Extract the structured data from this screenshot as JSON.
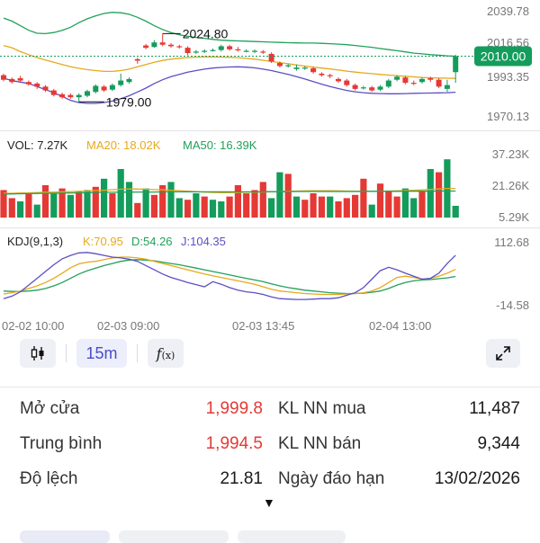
{
  "chart": {
    "price_axis": [
      "2039.78",
      "2016.56",
      "1993.35",
      "1970.13"
    ],
    "current_price": "2010.00",
    "high_label": "2024.80",
    "low_label": "1979.00",
    "volume_legend": {
      "vol": "VOL: 7.27K",
      "ma20": "MA20: 18.02K",
      "ma50": "MA50: 16.39K"
    },
    "volume_axis": [
      "37.23K",
      "21.26K",
      "5.29K"
    ],
    "kdj_legend": {
      "name": "KDJ(9,1,3)",
      "k": "K:70.95",
      "d": "D:54.26",
      "j": "J:104.35"
    },
    "kdj_axis": [
      "112.68",
      "-14.58"
    ],
    "time_axis": [
      "02-02 10:00",
      "02-03 09:00",
      "02-03 13:45",
      "02-04 13:00"
    ],
    "colors": {
      "up": "#149c5c",
      "down": "#e53935",
      "ma_yellow": "#e6a91c",
      "ma_green": "#22a05a",
      "boll_purple": "#5b4fc4",
      "price_tag": "#149c5c"
    }
  },
  "chart_data": {
    "type": "candlestick",
    "y_range": [
      1970.13,
      2039.78
    ],
    "last_price": 2010.0,
    "candles": [
      {
        "o": 1997.5,
        "c": 1994.5,
        "h": 1998.5,
        "l": 1993.5
      },
      {
        "o": 1995.0,
        "c": 1993.0,
        "h": 1996.0,
        "l": 1992.0
      },
      {
        "o": 1995.5,
        "c": 1994.0,
        "h": 1997.0,
        "l": 1993.0
      },
      {
        "o": 1993.0,
        "c": 1991.5,
        "h": 1994.0,
        "l": 1990.5
      },
      {
        "o": 1992.0,
        "c": 1990.0,
        "h": 1993.0,
        "l": 1988.5
      },
      {
        "o": 1990.0,
        "c": 1987.5,
        "h": 1991.0,
        "l": 1986.5
      },
      {
        "o": 1987.5,
        "c": 1984.5,
        "h": 1988.5,
        "l": 1983.5
      },
      {
        "o": 1985.0,
        "c": 1983.0,
        "h": 1986.0,
        "l": 1982.0
      },
      {
        "o": 1984.5,
        "c": 1983.0,
        "h": 1985.5,
        "l": 1982.0
      },
      {
        "o": 1983.0,
        "c": 1984.5,
        "h": 1985.5,
        "l": 1980.0
      },
      {
        "o": 1984.0,
        "c": 1987.0,
        "h": 1988.0,
        "l": 1983.0
      },
      {
        "o": 1986.5,
        "c": 1990.5,
        "h": 1991.5,
        "l": 1985.5
      },
      {
        "o": 1990.0,
        "c": 1987.5,
        "h": 1991.0,
        "l": 1986.5
      },
      {
        "o": 1988.0,
        "c": 1991.0,
        "h": 1992.0,
        "l": 1987.0
      },
      {
        "o": 1991.0,
        "c": 1994.0,
        "h": 1998.5,
        "l": 1990.0
      },
      {
        "o": 1993.0,
        "c": 1995.0,
        "h": 1996.0,
        "l": 1992.0
      },
      {
        "o": 2008.0,
        "c": 2007.0,
        "h": 2009.0,
        "l": 2005.0
      },
      {
        "o": 2017.0,
        "c": 2015.5,
        "h": 2018.0,
        "l": 2014.5
      },
      {
        "o": 2016.0,
        "c": 2019.0,
        "h": 2020.5,
        "l": 2015.5
      },
      {
        "o": 2019.0,
        "c": 2017.5,
        "h": 2024.8,
        "l": 2016.5
      },
      {
        "o": 2017.5,
        "c": 2016.5,
        "h": 2018.5,
        "l": 2015.5
      },
      {
        "o": 2016.5,
        "c": 2016.0,
        "h": 2017.5,
        "l": 2015.0
      },
      {
        "o": 2015.5,
        "c": 2012.0,
        "h": 2016.5,
        "l": 2010.5
      },
      {
        "o": 2012.5,
        "c": 2013.0,
        "h": 2014.0,
        "l": 2011.5
      },
      {
        "o": 2013.0,
        "c": 2013.5,
        "h": 2014.5,
        "l": 2012.0
      },
      {
        "o": 2013.5,
        "c": 2014.0,
        "h": 2015.0,
        "l": 2013.0
      },
      {
        "o": 2014.0,
        "c": 2016.5,
        "h": 2017.5,
        "l": 2013.0
      },
      {
        "o": 2016.5,
        "c": 2014.5,
        "h": 2017.5,
        "l": 2013.5
      },
      {
        "o": 2014.5,
        "c": 2014.0,
        "h": 2016.0,
        "l": 2013.0
      },
      {
        "o": 2013.5,
        "c": 2013.5,
        "h": 2014.5,
        "l": 2012.5
      },
      {
        "o": 2013.0,
        "c": 2013.5,
        "h": 2014.5,
        "l": 2012.0
      },
      {
        "o": 2013.0,
        "c": 2012.5,
        "h": 2014.0,
        "l": 2011.5
      },
      {
        "o": 2011.5,
        "c": 2006.5,
        "h": 2012.5,
        "l": 2005.5
      },
      {
        "o": 2005.5,
        "c": 2003.5,
        "h": 2006.5,
        "l": 2002.5
      },
      {
        "o": 2003.5,
        "c": 2004.0,
        "h": 2005.0,
        "l": 2002.5
      },
      {
        "o": 2001.5,
        "c": 2002.5,
        "h": 2004.5,
        "l": 2000.5
      },
      {
        "o": 2002.0,
        "c": 2002.5,
        "h": 2003.5,
        "l": 2001.0
      },
      {
        "o": 2002.0,
        "c": 1999.5,
        "h": 2003.0,
        "l": 1998.5
      },
      {
        "o": 1998.5,
        "c": 1997.5,
        "h": 1999.5,
        "l": 1996.5
      },
      {
        "o": 1997.5,
        "c": 1997.0,
        "h": 1998.5,
        "l": 1995.5
      },
      {
        "o": 1995.0,
        "c": 1993.5,
        "h": 1996.0,
        "l": 1992.5
      },
      {
        "o": 1994.0,
        "c": 1991.0,
        "h": 1995.0,
        "l": 1990.0
      },
      {
        "o": 1991.0,
        "c": 1988.5,
        "h": 1992.0,
        "l": 1987.5
      },
      {
        "o": 1989.0,
        "c": 1989.5,
        "h": 1990.5,
        "l": 1988.0
      },
      {
        "o": 1989.5,
        "c": 1987.5,
        "h": 1990.5,
        "l": 1986.5
      },
      {
        "o": 1988.0,
        "c": 1990.0,
        "h": 1991.0,
        "l": 1987.0
      },
      {
        "o": 1990.0,
        "c": 1994.0,
        "h": 1995.0,
        "l": 1989.0
      },
      {
        "o": 1994.5,
        "c": 1996.5,
        "h": 1997.5,
        "l": 1993.5
      },
      {
        "o": 1996.0,
        "c": 1992.5,
        "h": 1997.0,
        "l": 1991.5
      },
      {
        "o": 1992.5,
        "c": 1992.0,
        "h": 1994.0,
        "l": 1991.0
      },
      {
        "o": 1993.0,
        "c": 1995.0,
        "h": 1996.0,
        "l": 1992.0
      },
      {
        "o": 1995.5,
        "c": 1994.5,
        "h": 1996.5,
        "l": 1993.0
      },
      {
        "o": 1994.5,
        "c": 1990.0,
        "h": 1995.5,
        "l": 1989.0
      },
      {
        "o": 1988.5,
        "c": 1991.0,
        "h": 1994.5,
        "l": 1986.5
      },
      {
        "o": 1999.5,
        "c": 2010.0,
        "h": 2011.0,
        "l": 1992.5
      }
    ],
    "bollinger": {
      "upper": [
        2035,
        2033,
        2030,
        2027,
        2025,
        2024.8,
        2025.5,
        2027,
        2029,
        2032,
        2034.5,
        2036.5,
        2038,
        2038.8,
        2038.5,
        2037.5,
        2035.5,
        2033,
        2030,
        2027.5,
        2025.5,
        2024,
        2023,
        2022.3,
        2021.7,
        2021,
        2020.5,
        2020.2,
        2020,
        2019.8,
        2019.6,
        2019.4,
        2019.2,
        2019,
        2018.8,
        2018.7,
        2018.6,
        2018.6,
        2018.4,
        2018.2,
        2017.9,
        2017.5,
        2017,
        2016.4,
        2015.8,
        2015,
        2014.3,
        2013.6,
        2012.8,
        2012,
        2011.5,
        2011,
        2010.6,
        2010.2,
        2010
      ],
      "middle": [
        2017,
        2015.5,
        2013,
        2011,
        2009,
        2007.5,
        2006,
        2004.5,
        2003,
        2002,
        2001.2,
        2000.5,
        2000,
        2000,
        2000.5,
        2001.5,
        2003,
        2004.5,
        2006,
        2007.2,
        2008,
        2008.6,
        2009,
        2009.3,
        2009.5,
        2009.5,
        2009.4,
        2009.2,
        2009,
        2008.5,
        2008,
        2007.3,
        2006.5,
        2005.8,
        2005,
        2004.2,
        2003.5,
        2002.8,
        2002.2,
        2001.6,
        2000.9,
        2000.2,
        1999.5,
        1999,
        1998.5,
        1998,
        1997.6,
        1997.2,
        1996.8,
        1996.4,
        1996,
        1995.8,
        1995.6,
        1995.5,
        1995.4
      ],
      "lower": [
        1995.5,
        1994,
        1993,
        1992,
        1990,
        1988,
        1986,
        1983.5,
        1981,
        1979.5,
        1979,
        1979,
        1979.5,
        1980.5,
        1982,
        1984,
        1986.5,
        1989,
        1992,
        1994.5,
        1996.5,
        1998,
        1999.5,
        2000.5,
        2001.5,
        2002.2,
        2002.6,
        2002.9,
        2003,
        2002.8,
        2002.3,
        2001.5,
        2000.5,
        1999.3,
        1998,
        1996.5,
        1995,
        1993.3,
        1991.6,
        1990,
        1988.7,
        1987.5,
        1986.6,
        1986,
        1985.6,
        1985.4,
        1985.3,
        1985.3,
        1985.4,
        1985.6,
        1985.7,
        1985.8,
        1985.9,
        1986,
        1986.3
      ]
    },
    "volume": {
      "y_range": [
        0,
        40
      ],
      "values": [
        17,
        12,
        10,
        15,
        8,
        20,
        15,
        18,
        14,
        16,
        17,
        19,
        24,
        15,
        30,
        22,
        9,
        18,
        14,
        20,
        22,
        12,
        11,
        15,
        13,
        11,
        10,
        13,
        20,
        15,
        17,
        22,
        12,
        28,
        27,
        13,
        11,
        15,
        13,
        13,
        10,
        12,
        14,
        24,
        8,
        21,
        16,
        13,
        18,
        12,
        16,
        30,
        28,
        36,
        7.27
      ],
      "ma20": [
        15,
        15,
        15.2,
        15.3,
        15.5,
        15.6,
        15.7,
        15.9,
        16,
        16.2,
        16.4,
        16.7,
        16.9,
        17.2,
        17.5,
        17.7,
        17.6,
        17.5,
        17.3,
        17.1,
        16.9,
        16.6,
        16.3,
        16,
        15.7,
        15.5,
        15.4,
        15.4,
        15.5,
        15.6,
        15.7,
        15.8,
        15.9,
        16.1,
        16.3,
        16.4,
        16.5,
        16.6,
        16.6,
        16.6,
        16.5,
        16.4,
        16.3,
        16.3,
        16.2,
        16.3,
        16.4,
        16.5,
        16.7,
        16.9,
        17.1,
        17.4,
        17.7,
        18.0,
        18.02
      ],
      "ma50": [
        14.5,
        14.6,
        14.7,
        14.8,
        14.9,
        15,
        15,
        15.1,
        15.2,
        15.3,
        15.4,
        15.5,
        15.6,
        15.6,
        15.7,
        15.7,
        15.8,
        15.8,
        15.8,
        15.9,
        15.9,
        15.9,
        15.9,
        15.9,
        15.9,
        15.9,
        15.9,
        15.9,
        15.9,
        15.9,
        15.9,
        16,
        16,
        16,
        16,
        16.1,
        16.1,
        16.1,
        16.1,
        16.1,
        16.1,
        16.1,
        16.1,
        16.2,
        16.2,
        16.2,
        16.2,
        16.2,
        16.3,
        16.3,
        16.3,
        16.3,
        16.4,
        16.4,
        16.39
      ],
      "up": [
        false,
        false,
        true,
        false,
        true,
        false,
        true,
        false,
        true,
        false,
        true,
        false,
        true,
        false,
        true,
        true,
        false,
        true,
        false,
        false,
        true,
        true,
        false,
        true,
        false,
        true,
        true,
        false,
        false,
        false,
        false,
        false,
        true,
        true,
        false,
        true,
        false,
        false,
        false,
        true,
        false,
        false,
        false,
        false,
        true,
        false,
        false,
        false,
        true,
        true,
        false,
        true,
        false,
        true,
        true
      ]
    },
    "kdj": {
      "y_range": [
        -14.58,
        112.68
      ],
      "k": [
        13,
        16,
        20,
        26,
        32,
        40,
        50,
        62,
        75,
        84,
        88,
        90,
        94,
        98,
        100,
        100,
        98,
        95,
        90,
        85,
        80,
        75,
        70,
        65,
        60,
        56,
        52,
        48,
        44,
        40,
        36,
        30,
        24,
        20,
        18,
        16,
        14,
        13,
        12,
        12,
        12,
        13,
        14,
        16,
        20,
        28,
        40,
        52,
        55,
        52,
        48,
        50,
        55,
        62,
        70.95
      ],
      "d": [
        20,
        19,
        19,
        20,
        22,
        26,
        32,
        40,
        50,
        60,
        68,
        74,
        80,
        85,
        90,
        93,
        94,
        93,
        91,
        88,
        85,
        82,
        78,
        74,
        70,
        66,
        62,
        58,
        54,
        50,
        46,
        42,
        37,
        32,
        28,
        25,
        22,
        20,
        18,
        16,
        15,
        14,
        14,
        15,
        17,
        20,
        26,
        34,
        40,
        44,
        46,
        47,
        49,
        51,
        54.26
      ],
      "j": [
        2,
        8,
        18,
        34,
        50,
        66,
        82,
        96,
        104,
        110,
        111,
        108,
        104,
        100,
        98,
        95,
        90,
        80,
        70,
        60,
        52,
        46,
        40,
        35,
        30,
        42,
        36,
        28,
        22,
        18,
        16,
        12,
        6,
        2,
        1,
        0,
        0,
        1,
        2,
        2,
        4,
        10,
        16,
        28,
        48,
        68,
        76,
        70,
        62,
        55,
        48,
        50,
        62,
        85,
        104.35
      ]
    }
  },
  "toolbar": {
    "candle_icon": "candlestick-icon",
    "interval_label": "15m",
    "fx_label": "f(x)",
    "expand_icon": "expand-icon"
  },
  "info": {
    "rows": [
      {
        "label": "Mở cửa",
        "value": "1,999.8",
        "right_label": "KL NN mua",
        "right_value": "11,487"
      },
      {
        "label": "Trung bình",
        "value": "1,994.5",
        "right_label": "KL NN bán",
        "right_value": "9,344"
      },
      {
        "label": "Độ lệch",
        "value": "21.81",
        "right_label": "Ngày đáo hạn",
        "right_value": "13/02/2026"
      }
    ],
    "expand_arrow": "▼"
  }
}
